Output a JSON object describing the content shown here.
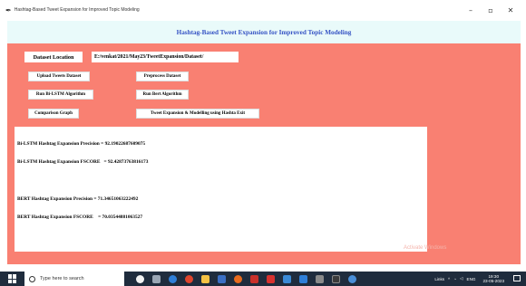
{
  "window": {
    "title": "Hashtag-Based Tweet Expansion for Improved Topic Modeling",
    "icon": "feather-icon",
    "controls": {
      "minimize": "–",
      "maximize": "▫",
      "close": "✕"
    }
  },
  "header": {
    "title": "Hashtag-Based Tweet Expansion for Improved Topic Modeling",
    "title_color": "#3553c4",
    "background": "#e9fafa"
  },
  "main": {
    "background": "#f98072",
    "dataset_label": "Dataset Location",
    "dataset_path": "E:/venkat/2021/May23/TweetExpansion/Dataset/"
  },
  "buttons": {
    "upload": "Upload Tweets Dataset",
    "preprocess": "Preprocess Dataset",
    "run_bilstm": "Run Bi-LSTM Algorithm",
    "run_bert": "Run Bert Algorithm",
    "comparison": "Comparison Graph",
    "expansion": "Tweet Expansion & Modelling using Hashta Exit"
  },
  "output": {
    "lines": [
      "Bi-LSTM Hashtag Expansion Precision = 92.19022687609075",
      "Bi-LSTM Hashtag Expansion FSCORE   = 92.42873763816173",
      "",
      "BERT Hashtag Expansion Precision = 71.34651063222492",
      "BERT Hashtag Expansion FSCORE    = 70.03544881063527"
    ]
  },
  "watermark": "Activate Windows",
  "taskbar": {
    "search_placeholder": "Type here to search",
    "tray": {
      "links": "Links",
      "lang": "ENG",
      "time": "19:30",
      "date": "23-05-2023"
    }
  }
}
